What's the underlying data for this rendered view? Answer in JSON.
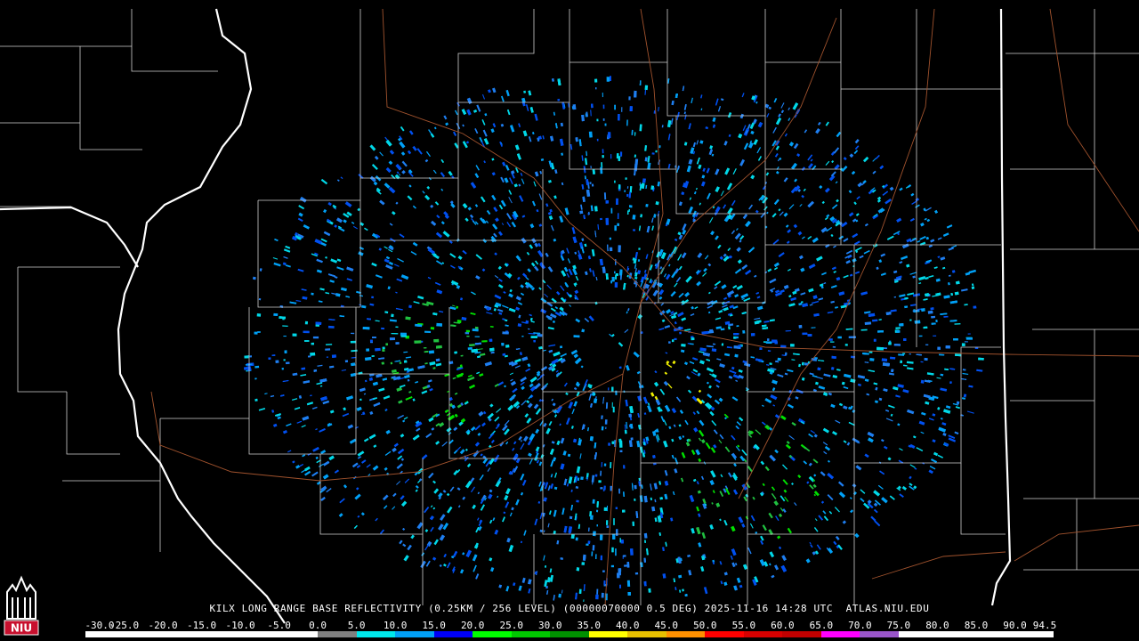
{
  "header": {
    "product": "KILX LONG RANGE BASE REFLECTIVITY (0.25KM / 256 LEVEL) (00000070000 0.5 DEG)",
    "datetime": "2025-11-16 14:28 UTC",
    "site": "ATLAS.NIU.EDU"
  },
  "logo": {
    "text": "NIU",
    "colors": {
      "primary": "#c8102e",
      "secondary": "#ffffff"
    }
  },
  "color_scale": {
    "labels": [
      "-30.0",
      "-25.0",
      "-20.0",
      "-15.0",
      "-10.0",
      "-5.0",
      "0.0",
      "5.0",
      "10.0",
      "15.0",
      "20.0",
      "25.0",
      "30.0",
      "35.0",
      "40.0",
      "45.0",
      "50.0",
      "55.0",
      "60.0",
      "65.0",
      "70.0",
      "75.0",
      "80.0",
      "85.0",
      "90.0",
      "94.5"
    ],
    "colors": [
      "#ffffff",
      "#ffffff",
      "#ffffff",
      "#ffffff",
      "#ffffff",
      "#ffffff",
      "#808080",
      "#00e8ec",
      "#01a0f6",
      "#0000f6",
      "#00ff00",
      "#00c800",
      "#009000",
      "#ffff00",
      "#e7c000",
      "#ff9000",
      "#ff0000",
      "#d60000",
      "#c00000",
      "#ff00ff",
      "#9955c9",
      "#ffffff",
      "#ffffff",
      "#ffffff",
      "#ffffff"
    ]
  },
  "map": {
    "radar_site": "KILX",
    "background": "#000000",
    "county_line_color": "#ffffff",
    "state_line_color": "#ffffff",
    "river_color": "#ffffff",
    "road_color": "#a0522d",
    "echo_colors": [
      "#00a0f6",
      "#00d8e8",
      "#1e7ef0",
      "#0050f0",
      "#00e000",
      "#20c040",
      "#f0f000"
    ]
  }
}
